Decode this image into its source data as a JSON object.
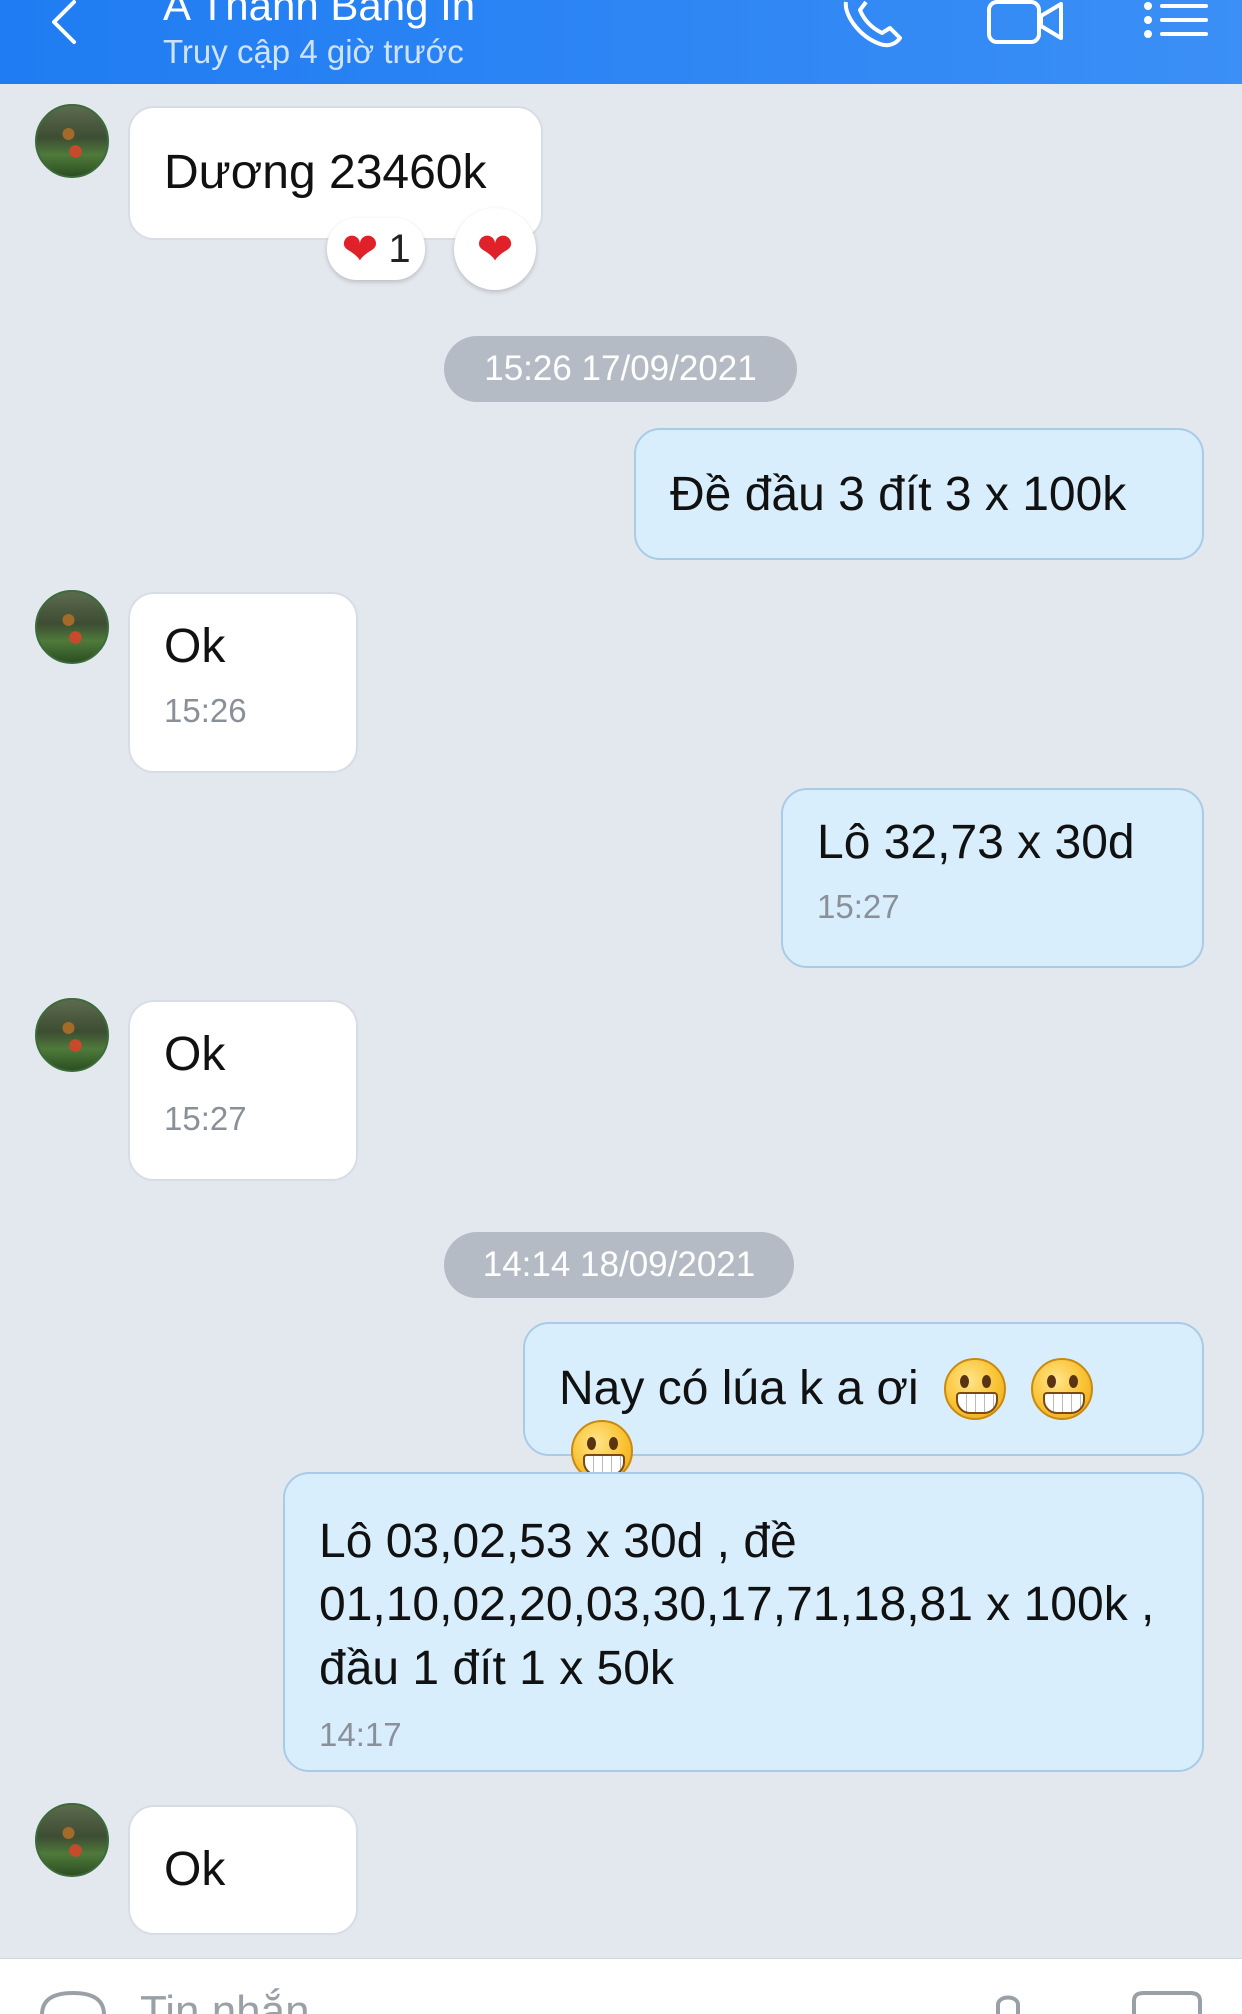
{
  "header": {
    "contact_name": "A Thanh Bảng In",
    "status": "Truy cập 4 giờ trước"
  },
  "messages": [
    {
      "text": "Dương 23460k",
      "reaction_count": "1"
    },
    {
      "text": "Đề đầu 3 đít 3 x 100k"
    },
    {
      "text": "Ok",
      "time": "15:26"
    },
    {
      "text": "Lô 32,73 x 30d",
      "time": "15:27"
    },
    {
      "text": "Ok",
      "time": "15:27"
    },
    {
      "text": "Nay có lúa k a ơi"
    },
    {
      "text": "Lô 03,02,53 x 30d , đề 01,10,02,20,03,30,17,71,18,81 x 100k , đầu 1 đít 1 x 50k",
      "time": "14:17"
    },
    {
      "text": "Ok"
    }
  ],
  "date_separators": [
    "15:26 17/09/2021",
    "14:14 18/09/2021"
  ],
  "composer": {
    "placeholder": "Tin nhắn"
  },
  "icons": {
    "back": "chevron-left-icon",
    "call": "phone-icon",
    "video": "video-camera-icon",
    "menu": "list-menu-icon",
    "reaction": "heart-icon",
    "emoji": "grinning-face-icon"
  },
  "colors": {
    "header": "#1f7cf2",
    "background": "#e3e7ee",
    "outgoing_bubble": "#d9eefc",
    "incoming_bubble": "#ffffff",
    "heart": "#e0212a"
  }
}
